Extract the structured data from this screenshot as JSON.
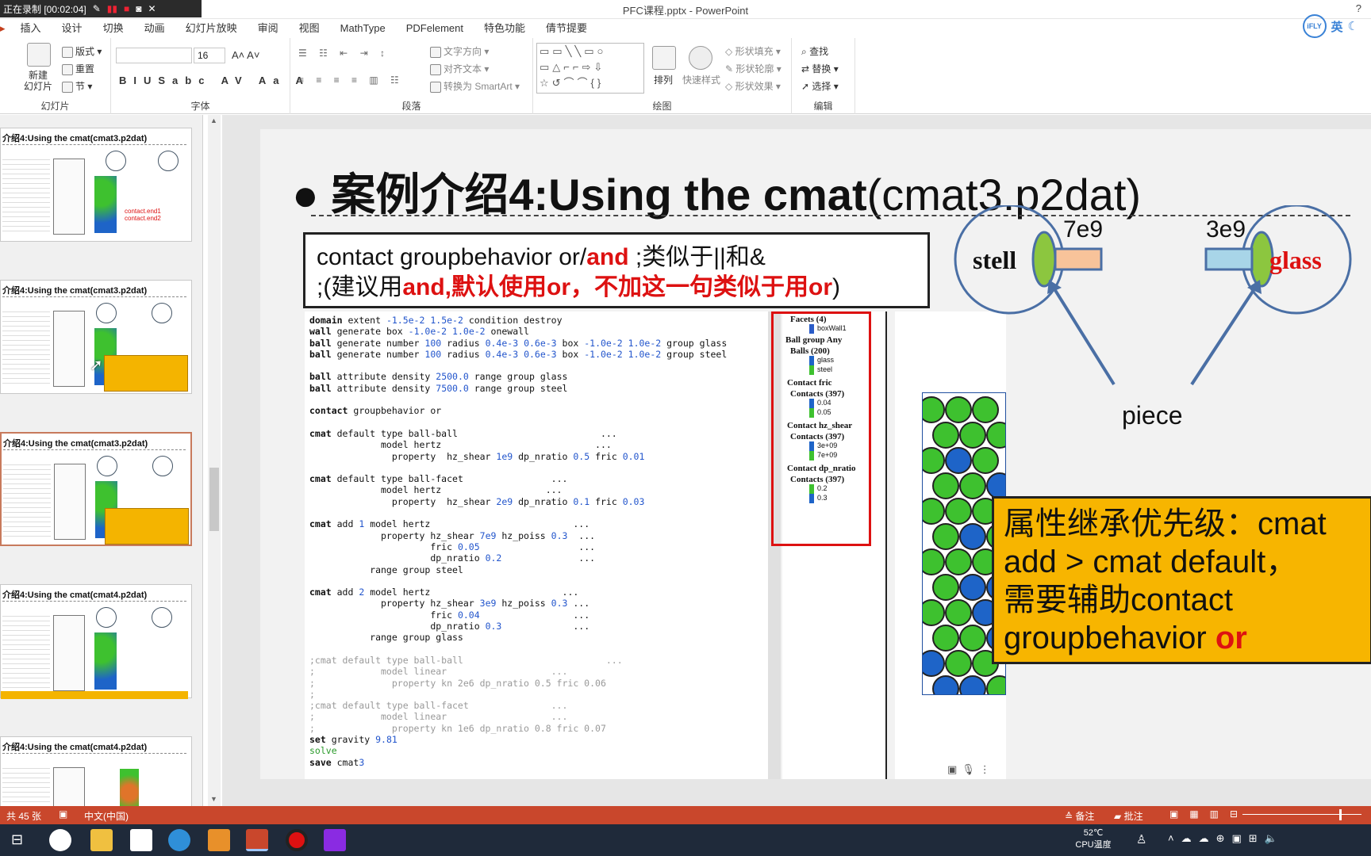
{
  "recorder": {
    "status": "正在录制 [00:02:04]"
  },
  "window": {
    "title": "PFC课程.pptx - PowerPoint",
    "help": "?"
  },
  "tabs": [
    "插入",
    "设计",
    "切换",
    "动画",
    "幻灯片放映",
    "审阅",
    "视图",
    "MathType",
    "PDFelement",
    "特色功能",
    "倩节提要"
  ],
  "ime": {
    "logo": "iFLY",
    "lang": "英"
  },
  "ribbon": {
    "groups": [
      {
        "label": "幻灯片"
      },
      {
        "label": "字体"
      },
      {
        "label": "段落"
      },
      {
        "label": "绘图"
      },
      {
        "label": "编辑"
      }
    ],
    "slides": {
      "new": "新建\n幻灯片",
      "layout": "版式",
      "reset": "重置",
      "section": "节"
    },
    "font": {
      "size": "16"
    },
    "paragraph": {
      "text_dir": "文字方向",
      "align_text": "对齐文本",
      "smartart": "转换为 SmartArt"
    },
    "drawing": {
      "arrange": "排列",
      "quick_styles": "快速样式",
      "fill": "形状填充",
      "outline": "形状轮廓",
      "effects": "形状效果"
    },
    "editing": {
      "find": "查找",
      "replace": "替换",
      "select": "选择"
    }
  },
  "thumbs": [
    {
      "title": "介绍4:Using the cmat(cmat3.p2dat)",
      "sub": "contact.end1\ncontact.end2"
    },
    {
      "title": "介绍4:Using the cmat(cmat3.p2dat)"
    },
    {
      "title": "介绍4:Using the cmat(cmat3.p2dat)"
    },
    {
      "title": "介绍4:Using the cmat(cmat4.p2dat)"
    },
    {
      "title": "介绍4:Using the cmat(cmat4.p2dat)"
    }
  ],
  "slide": {
    "bullet": "●",
    "title_bold": "案例介绍4:Using the cmat",
    "title_norm": "(cmat3.p2dat)",
    "note_line1_a": "contact groupbehavior or/",
    "note_line1_b": "and",
    "note_line1_c": "    ;类似于||和&",
    "note_line2_a": ";(建议用",
    "note_line2_b": "and,默认使用or，不加这一句类似于用or",
    "note_line2_c": ")",
    "code": [
      "domain extent -1.5e-2 1.5e-2 condition destroy",
      "wall generate box -1.0e-2 1.0e-2 onewall",
      "ball generate number 100 radius 0.4e-3 0.6e-3 box -1.0e-2 1.0e-2 group glass",
      "ball generate number 100 radius 0.4e-3 0.6e-3 box -1.0e-2 1.0e-2 group steel",
      "",
      "ball attribute density 2500.0 range group glass",
      "ball attribute density 7500.0 range group steel",
      "",
      "contact groupbehavior or",
      "",
      "cmat default type ball-ball                          ...",
      "             model hertz                            ...",
      "               property  hz_shear 1e9 dp_nratio 0.5 fric 0.01",
      "",
      "cmat default type ball-facet                ...",
      "             model hertz                   ...",
      "               property  hz_shear 2e9 dp_nratio 0.1 fric 0.03",
      "",
      "cmat add 1 model hertz                          ...",
      "             property hz_shear 7e9 hz_poiss 0.3  ...",
      "                      fric 0.05                  ...",
      "                      dp_nratio 0.2              ...",
      "           range group steel",
      "",
      "cmat add 2 model hertz                        ...",
      "             property hz_shear 3e9 hz_poiss 0.3 ...",
      "                      fric 0.04                 ...",
      "                      dp_nratio 0.3             ...",
      "           range group glass",
      "",
      ";cmat default type ball-ball                          ...",
      ";            model linear                   ...",
      ";              property kn 2e6 dp_nratio 0.5 fric 0.06",
      ";",
      ";cmat default type ball-facet               ...",
      ";            model linear                   ...",
      ";              property kn 1e6 dp_nratio 0.8 fric 0.07",
      "set gravity 9.81",
      "solve",
      "save cmat3"
    ],
    "legend": {
      "facets": "Facets (4)",
      "boxwall": "boxWall1",
      "ballgroup": "Ball group Any",
      "balls": "Balls (200)",
      "glass": "glass",
      "steel": "steel",
      "fric": "Contact fric",
      "fric_contacts": "Contacts (397)",
      "fric_a": "0.04",
      "fric_b": "0.05",
      "hz": "Contact hz_shear",
      "hz_contacts": "Contacts (397)",
      "hz_a": "3e+09",
      "hz_b": "7e+09",
      "dp": "Contact dp_nratio",
      "dp_contacts": "Contacts (397)",
      "dp_a": "0.2",
      "dp_b": "0.3"
    },
    "diagram": {
      "left": "stell",
      "right": "glass",
      "val_left": "7e9",
      "val_right": "3e9",
      "piece": "piece"
    },
    "callout": {
      "line1": "属性继承优先级：cmat",
      "line2": "add > cmat default，",
      "line3": "需要辅助contact",
      "line4a": "groupbehavior ",
      "line4b": "or"
    }
  },
  "statusbar": {
    "slides": "共 45 张",
    "lang": "中文(中国)",
    "notes": "备注",
    "comments": "批注"
  },
  "taskbar": {
    "temp": "52℃",
    "temp_label": "CPU温度"
  },
  "colors": {
    "accent": "#c43e1c",
    "status": "#c9472c",
    "callout": "#f7b500",
    "red": "#dd1111",
    "ball_green": "#3ec12f",
    "ball_blue": "#1e64c8"
  }
}
